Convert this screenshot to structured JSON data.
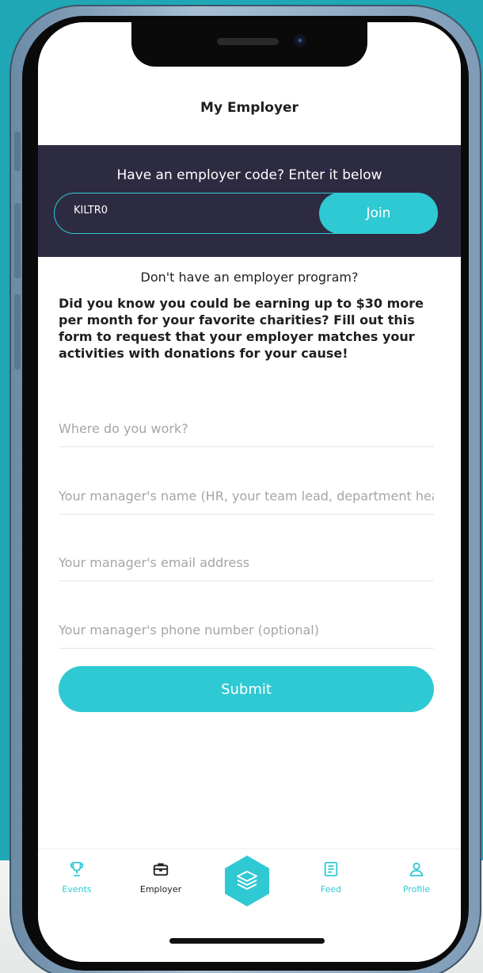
{
  "header": {
    "title": "My Employer"
  },
  "employer_code": {
    "prompt": "Have an employer code? Enter it below",
    "value": "KILTR0",
    "join_label": "Join"
  },
  "request_form": {
    "heading": "Don't have an employer program?",
    "intro": "Did you know you could be earning up to $30 more per month for your favorite charities? Fill out this form to request that your employer matches your activities with donations for your cause!",
    "fields": [
      {
        "placeholder": "Where do you work?"
      },
      {
        "placeholder": "Your manager's name (HR, your team lead, department head)"
      },
      {
        "placeholder": "Your manager's email address"
      },
      {
        "placeholder": "Your manager's phone number (optional)"
      }
    ],
    "submit_label": "Submit"
  },
  "tabbar": {
    "items": [
      {
        "label": "Events",
        "icon": "trophy-icon"
      },
      {
        "label": "Employer",
        "icon": "briefcase-icon"
      },
      {
        "label": "",
        "icon": "layers-icon"
      },
      {
        "label": "Feed",
        "icon": "document-icon"
      },
      {
        "label": "Profile",
        "icon": "user-icon"
      }
    ]
  },
  "colors": {
    "accent": "#2fc9d3",
    "panel": "#2d2b42",
    "background": "#1fa7b5"
  }
}
